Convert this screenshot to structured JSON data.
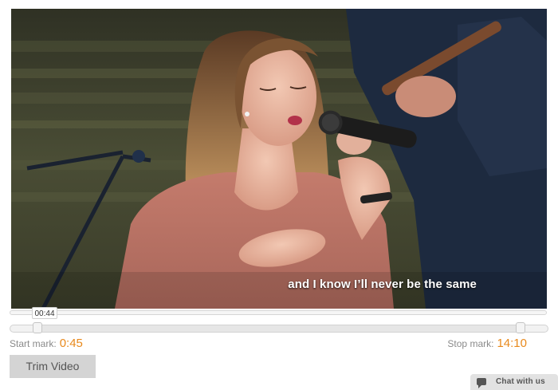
{
  "video": {
    "subtitle": "and I know I’ll never be the same",
    "current_time": "00:44"
  },
  "trim": {
    "start_label": "Start mark:",
    "start_value": "0:45",
    "stop_label": "Stop mark:",
    "stop_value": "14:10",
    "button_label": "Trim Video"
  },
  "chat": {
    "label": "Chat with us",
    "icon": "speech-bubble-icon"
  },
  "colors": {
    "accent": "#e8891c",
    "button_bg": "#d4d4d4"
  }
}
